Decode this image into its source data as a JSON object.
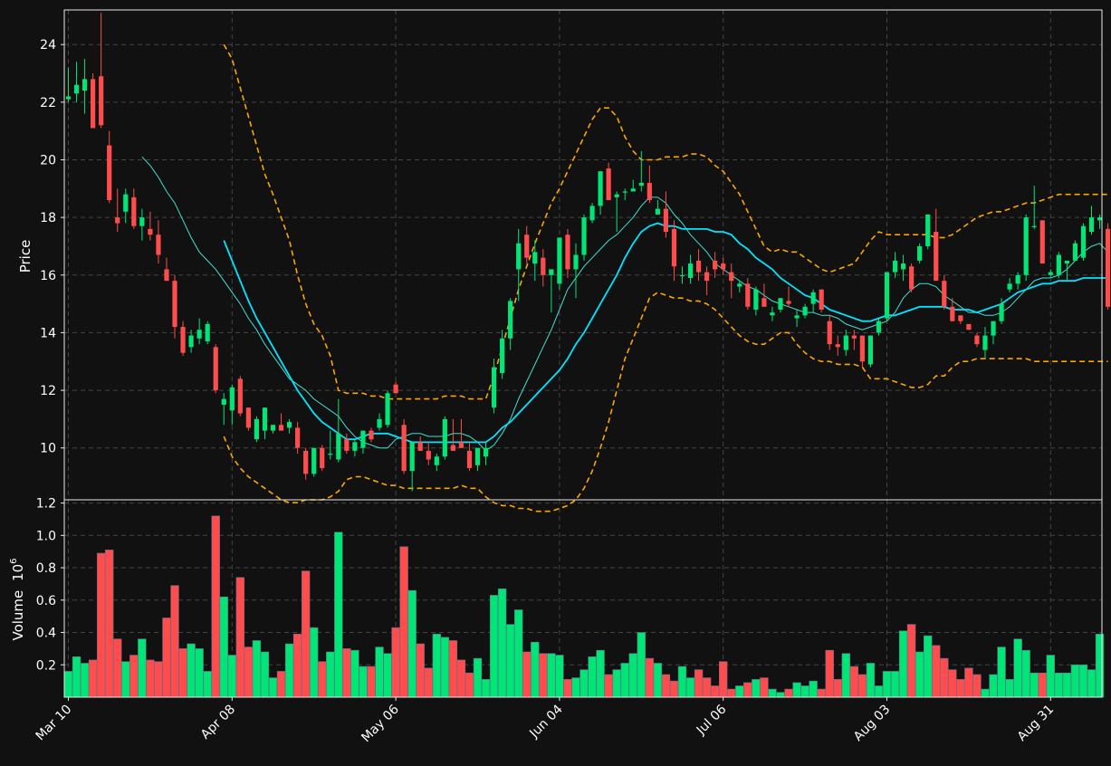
{
  "chart_data": {
    "type": "candlestick",
    "theme": {
      "background": "#111111",
      "up_color": "#00e676",
      "down_color": "#ff4d4d",
      "ma_fast_color": "#40e0d0",
      "ma_slow_color": "#00e5ff",
      "band_color": "#ffa500",
      "grid_color": "#444444",
      "text_color": "#ffffff"
    },
    "x_axis": {
      "tick_labels": [
        "Mar 10",
        "Apr 08",
        "May 06",
        "Jun 04",
        "Jul 06",
        "Aug 03",
        "Aug 31"
      ],
      "tick_indices": [
        0,
        20,
        40,
        60,
        80,
        100,
        120
      ],
      "label_rotation": 45
    },
    "price_panel": {
      "ylabel": "Price",
      "ylim": [
        8.2,
        25.2
      ],
      "yticks": [
        10,
        12,
        14,
        16,
        18,
        20,
        22,
        24
      ],
      "grid": true
    },
    "volume_panel": {
      "ylabel": "Volume",
      "ylabel_exponent": "6",
      "ylim": [
        0,
        1.22
      ],
      "yticks": [
        0.2,
        0.4,
        0.6,
        0.8,
        1.0,
        1.2
      ],
      "tick_labels": [
        "0.2",
        "0.4",
        "0.6",
        "0.8",
        "1.0",
        "1.2"
      ],
      "grid": true
    },
    "ohlc": [
      [
        22.1,
        23.2,
        22.0,
        22.2
      ],
      [
        22.3,
        23.4,
        22.0,
        22.6
      ],
      [
        22.4,
        23.5,
        21.6,
        22.8
      ],
      [
        22.8,
        23.0,
        21.1,
        21.1
      ],
      [
        22.9,
        25.1,
        21.1,
        21.2
      ],
      [
        20.5,
        21.0,
        18.5,
        18.6
      ],
      [
        18.0,
        19.0,
        17.5,
        17.8
      ],
      [
        18.2,
        19.0,
        17.8,
        18.8
      ],
      [
        18.7,
        19.0,
        17.6,
        17.7
      ],
      [
        17.7,
        18.3,
        17.2,
        18.0
      ],
      [
        17.6,
        18.2,
        17.2,
        17.4
      ],
      [
        17.4,
        17.9,
        16.4,
        16.7
      ],
      [
        16.2,
        16.6,
        15.8,
        15.8
      ],
      [
        15.8,
        16.0,
        13.8,
        14.2
      ],
      [
        14.2,
        14.4,
        13.2,
        13.3
      ],
      [
        13.5,
        14.1,
        13.3,
        13.9
      ],
      [
        13.8,
        14.5,
        13.6,
        14.1
      ],
      [
        13.7,
        14.4,
        13.6,
        14.3
      ],
      [
        13.5,
        13.6,
        11.9,
        12.0
      ],
      [
        11.5,
        11.9,
        10.8,
        11.7
      ],
      [
        11.3,
        12.2,
        10.8,
        12.1
      ],
      [
        12.4,
        12.5,
        11.1,
        11.2
      ],
      [
        11.4,
        11.4,
        10.6,
        10.7
      ],
      [
        10.3,
        11.1,
        10.2,
        11.0
      ],
      [
        10.6,
        11.4,
        10.3,
        11.4
      ],
      [
        10.6,
        10.8,
        10.5,
        10.8
      ],
      [
        10.8,
        11.2,
        10.6,
        10.6
      ],
      [
        10.7,
        11.0,
        10.5,
        10.9
      ],
      [
        10.7,
        10.9,
        9.8,
        10.0
      ],
      [
        9.9,
        10.0,
        8.9,
        9.1
      ],
      [
        9.1,
        10.0,
        9.0,
        10.0
      ],
      [
        10.0,
        10.1,
        9.2,
        9.3
      ],
      [
        9.8,
        10.6,
        9.6,
        9.8
      ],
      [
        9.6,
        11.7,
        9.5,
        10.5
      ],
      [
        10.3,
        10.5,
        9.8,
        9.9
      ],
      [
        9.9,
        10.3,
        9.7,
        10.2
      ],
      [
        10.0,
        10.6,
        9.8,
        10.6
      ],
      [
        10.6,
        10.7,
        10.2,
        10.3
      ],
      [
        10.7,
        11.2,
        10.6,
        11.0
      ],
      [
        10.8,
        12.0,
        10.7,
        11.9
      ],
      [
        12.2,
        12.3,
        11.9,
        11.9
      ],
      [
        10.8,
        11.0,
        9.1,
        9.2
      ],
      [
        9.2,
        10.2,
        8.5,
        10.2
      ],
      [
        10.2,
        10.4,
        9.9,
        9.9
      ],
      [
        9.9,
        10.2,
        9.4,
        9.6
      ],
      [
        9.4,
        9.8,
        9.2,
        9.7
      ],
      [
        9.7,
        11.1,
        9.6,
        11.0
      ],
      [
        10.1,
        11.0,
        9.9,
        9.9
      ],
      [
        10.2,
        11.0,
        10.0,
        10.0
      ],
      [
        9.9,
        10.2,
        9.2,
        9.3
      ],
      [
        9.4,
        10.0,
        9.2,
        10.0
      ],
      [
        9.7,
        10.2,
        9.4,
        10.0
      ],
      [
        11.4,
        13.1,
        11.2,
        12.8
      ],
      [
        12.6,
        14.1,
        12.4,
        13.8
      ],
      [
        13.8,
        15.2,
        13.4,
        15.1
      ],
      [
        16.2,
        17.6,
        15.1,
        17.1
      ],
      [
        17.4,
        17.7,
        16.4,
        16.6
      ],
      [
        16.4,
        17.2,
        15.8,
        16.8
      ],
      [
        16.6,
        16.9,
        15.6,
        16.0
      ],
      [
        16.0,
        16.2,
        14.7,
        16.2
      ],
      [
        15.7,
        17.3,
        15.5,
        17.3
      ],
      [
        17.4,
        17.6,
        15.9,
        16.2
      ],
      [
        16.2,
        17.1,
        15.2,
        16.7
      ],
      [
        16.7,
        18.1,
        16.5,
        18.0
      ],
      [
        17.9,
        18.5,
        17.8,
        18.4
      ],
      [
        18.4,
        19.6,
        18.1,
        19.6
      ],
      [
        19.7,
        19.9,
        18.6,
        18.6
      ],
      [
        18.7,
        18.9,
        17.5,
        18.8
      ],
      [
        18.9,
        19.0,
        18.6,
        18.9
      ],
      [
        18.9,
        19.3,
        18.9,
        19.0
      ],
      [
        19.1,
        20.3,
        18.9,
        19.2
      ],
      [
        19.2,
        19.8,
        18.5,
        18.6
      ],
      [
        18.1,
        18.6,
        18.1,
        18.3
      ],
      [
        18.3,
        18.9,
        17.3,
        17.5
      ],
      [
        17.6,
        17.9,
        15.8,
        16.3
      ],
      [
        16.0,
        16.3,
        15.7,
        16.0
      ],
      [
        15.9,
        16.7,
        15.7,
        16.4
      ],
      [
        16.5,
        16.9,
        15.8,
        16.1
      ],
      [
        16.1,
        16.3,
        15.3,
        15.8
      ],
      [
        16.5,
        16.8,
        15.9,
        16.2
      ],
      [
        16.4,
        16.6,
        16.0,
        16.2
      ],
      [
        16.1,
        16.4,
        15.2,
        15.8
      ],
      [
        15.6,
        15.8,
        15.4,
        15.7
      ],
      [
        15.7,
        15.9,
        14.8,
        14.9
      ],
      [
        14.8,
        15.6,
        14.6,
        15.5
      ],
      [
        15.2,
        15.7,
        14.9,
        14.9
      ],
      [
        14.6,
        14.9,
        14.4,
        14.7
      ],
      [
        14.8,
        15.2,
        14.7,
        15.2
      ],
      [
        15.1,
        15.6,
        14.9,
        15.0
      ],
      [
        14.5,
        14.8,
        14.2,
        14.6
      ],
      [
        14.6,
        15.0,
        14.5,
        14.9
      ],
      [
        15.0,
        15.5,
        14.7,
        15.4
      ],
      [
        15.5,
        15.5,
        14.7,
        14.8
      ],
      [
        14.4,
        14.6,
        13.4,
        13.6
      ],
      [
        13.6,
        13.9,
        13.2,
        13.5
      ],
      [
        13.4,
        14.1,
        13.2,
        13.9
      ],
      [
        13.9,
        14.1,
        13.4,
        13.8
      ],
      [
        13.9,
        13.9,
        12.8,
        13.0
      ],
      [
        12.9,
        13.9,
        12.8,
        13.9
      ],
      [
        14.0,
        14.5,
        13.9,
        14.4
      ],
      [
        14.5,
        16.1,
        14.4,
        16.1
      ],
      [
        16.1,
        16.8,
        15.9,
        16.5
      ],
      [
        16.2,
        16.7,
        15.8,
        16.4
      ],
      [
        16.3,
        16.4,
        15.4,
        15.5
      ],
      [
        16.5,
        17.1,
        16.4,
        17.0
      ],
      [
        17.0,
        18.1,
        16.9,
        18.1
      ],
      [
        17.5,
        18.3,
        17.3,
        15.8
      ],
      [
        15.8,
        16.0,
        14.8,
        14.9
      ],
      [
        14.9,
        15.2,
        14.4,
        14.4
      ],
      [
        14.6,
        14.6,
        14.3,
        14.4
      ],
      [
        14.3,
        14.3,
        14.1,
        14.1
      ],
      [
        13.9,
        14.0,
        13.5,
        13.6
      ],
      [
        13.4,
        14.2,
        13.1,
        13.9
      ],
      [
        13.9,
        14.4,
        13.6,
        14.4
      ],
      [
        14.4,
        15.2,
        14.3,
        15.0
      ],
      [
        15.5,
        15.9,
        15.4,
        15.7
      ],
      [
        15.7,
        16.1,
        15.5,
        16.0
      ],
      [
        16.0,
        18.1,
        15.8,
        18.0
      ],
      [
        17.7,
        19.1,
        17.6,
        17.7
      ],
      [
        17.9,
        17.9,
        16.4,
        16.4
      ],
      [
        16.0,
        16.2,
        15.9,
        16.1
      ],
      [
        16.0,
        16.8,
        15.9,
        16.7
      ],
      [
        16.4,
        16.5,
        15.8,
        16.5
      ],
      [
        16.5,
        17.2,
        16.5,
        17.1
      ],
      [
        16.6,
        17.8,
        16.5,
        17.7
      ],
      [
        17.5,
        18.4,
        17.4,
        18.0
      ],
      [
        17.9,
        18.1,
        17.6,
        18.0
      ],
      [
        17.6,
        17.8,
        14.8,
        14.9
      ]
    ],
    "ma_fast": [
      null,
      null,
      null,
      null,
      null,
      null,
      null,
      null,
      null,
      20.1,
      19.8,
      19.4,
      18.9,
      18.5,
      17.9,
      17.3,
      16.8,
      16.5,
      16.2,
      15.8,
      15.4,
      15.0,
      14.5,
      14.1,
      13.6,
      13.2,
      12.8,
      12.4,
      12.2,
      12.0,
      11.7,
      11.5,
      11.3,
      11.1,
      10.7,
      10.4,
      10.2,
      10.1,
      10.0,
      10.0,
      10.3,
      10.4,
      10.5,
      10.5,
      10.4,
      10.4,
      10.4,
      10.5,
      10.5,
      10.4,
      10.2,
      9.9,
      10.1,
      10.5,
      11.0,
      11.7,
      12.3,
      12.9,
      13.5,
      14.1,
      14.8,
      15.5,
      15.9,
      16.3,
      16.6,
      16.9,
      17.2,
      17.4,
      17.7,
      18.0,
      18.4,
      18.7,
      18.7,
      18.5,
      18.1,
      17.8,
      17.4,
      17.1,
      16.8,
      16.4,
      16.2,
      16.0,
      15.8,
      15.6,
      15.5,
      15.3,
      15.1,
      15.0,
      14.9,
      14.8,
      14.7,
      14.7,
      14.6,
      14.6,
      14.5,
      14.3,
      14.2,
      14.1,
      14.2,
      14.3,
      14.4,
      14.7,
      15.2,
      15.5,
      15.7,
      15.7,
      15.6,
      15.3,
      15.1,
      14.9,
      14.7,
      14.7,
      14.6,
      14.6,
      14.7,
      14.9,
      15.2,
      15.5,
      15.8,
      15.9,
      15.9,
      16.0,
      16.2,
      16.5,
      16.8,
      17.0,
      17.1,
      16.8
    ],
    "ma_slow": [
      null,
      null,
      null,
      null,
      null,
      null,
      null,
      null,
      null,
      null,
      null,
      null,
      null,
      null,
      null,
      null,
      null,
      null,
      null,
      17.2,
      16.5,
      15.8,
      15.1,
      14.5,
      14.0,
      13.5,
      13.0,
      12.5,
      12.0,
      11.6,
      11.2,
      10.9,
      10.7,
      10.5,
      10.3,
      10.3,
      10.4,
      10.5,
      10.5,
      10.5,
      10.4,
      10.3,
      10.2,
      10.2,
      10.2,
      10.2,
      10.2,
      10.2,
      10.2,
      10.2,
      10.2,
      10.2,
      10.4,
      10.7,
      10.9,
      11.2,
      11.5,
      11.8,
      12.1,
      12.4,
      12.7,
      13.1,
      13.6,
      14.0,
      14.5,
      15.0,
      15.5,
      16.0,
      16.6,
      17.1,
      17.5,
      17.7,
      17.8,
      17.7,
      17.7,
      17.6,
      17.6,
      17.6,
      17.6,
      17.5,
      17.5,
      17.4,
      17.1,
      16.9,
      16.6,
      16.4,
      16.2,
      15.9,
      15.7,
      15.5,
      15.3,
      15.2,
      15.0,
      14.8,
      14.7,
      14.6,
      14.5,
      14.4,
      14.4,
      14.5,
      14.6,
      14.6,
      14.7,
      14.8,
      14.9,
      14.9,
      14.9,
      14.9,
      14.8,
      14.8,
      14.8,
      14.7,
      14.8,
      14.9,
      15.0,
      15.2,
      15.4,
      15.5,
      15.6,
      15.7,
      15.7,
      15.8,
      15.8,
      15.8,
      15.9,
      15.9,
      15.9,
      15.9
    ],
    "band_upper": [
      null,
      null,
      null,
      null,
      null,
      null,
      null,
      null,
      null,
      null,
      null,
      null,
      null,
      null,
      null,
      null,
      null,
      null,
      null,
      24.0,
      23.5,
      22.5,
      21.5,
      20.5,
      19.5,
      18.8,
      18.0,
      17.2,
      16.0,
      15.0,
      14.3,
      13.9,
      13.2,
      12.0,
      11.9,
      11.9,
      11.9,
      11.8,
      11.8,
      11.7,
      11.7,
      11.7,
      11.7,
      11.7,
      11.7,
      11.7,
      11.8,
      11.8,
      11.8,
      11.7,
      11.7,
      11.7,
      12.5,
      13.5,
      14.5,
      15.5,
      16.3,
      17.1,
      17.8,
      18.5,
      19.0,
      19.6,
      20.2,
      20.8,
      21.4,
      21.8,
      21.8,
      21.5,
      20.8,
      20.3,
      20.0,
      20.0,
      20.0,
      20.1,
      20.1,
      20.1,
      20.2,
      20.2,
      20.1,
      19.8,
      19.6,
      19.2,
      18.8,
      18.2,
      17.6,
      17.0,
      16.8,
      16.9,
      16.8,
      16.8,
      16.6,
      16.4,
      16.2,
      16.1,
      16.2,
      16.3,
      16.4,
      16.8,
      17.2,
      17.5,
      17.4,
      17.4,
      17.4,
      17.4,
      17.4,
      17.4,
      17.3,
      17.3,
      17.4,
      17.6,
      17.8,
      18.0,
      18.1,
      18.2,
      18.2,
      18.3,
      18.4,
      18.5,
      18.5,
      18.6,
      18.7,
      18.8,
      18.8,
      18.8,
      18.8,
      18.8,
      18.8,
      18.8
    ],
    "band_lower": [
      null,
      null,
      null,
      null,
      null,
      null,
      null,
      null,
      null,
      null,
      null,
      null,
      null,
      null,
      null,
      null,
      null,
      null,
      null,
      10.4,
      9.7,
      9.3,
      9.0,
      8.8,
      8.6,
      8.4,
      8.2,
      8.1,
      8.1,
      8.2,
      8.2,
      8.2,
      8.3,
      8.5,
      8.9,
      9.0,
      9.0,
      8.9,
      8.8,
      8.7,
      8.7,
      8.6,
      8.6,
      8.6,
      8.6,
      8.6,
      8.6,
      8.6,
      8.7,
      8.6,
      8.6,
      8.3,
      8.1,
      8.0,
      8.0,
      7.9,
      7.9,
      7.8,
      7.8,
      7.8,
      7.9,
      8.0,
      8.2,
      8.6,
      9.2,
      10.0,
      10.9,
      12.0,
      13.1,
      13.8,
      14.5,
      15.2,
      15.4,
      15.3,
      15.2,
      15.2,
      15.1,
      15.1,
      15.0,
      14.8,
      14.5,
      14.2,
      13.9,
      13.7,
      13.6,
      13.6,
      13.8,
      14.0,
      14.0,
      13.6,
      13.3,
      13.1,
      13.0,
      13.0,
      12.9,
      12.9,
      12.9,
      12.8,
      12.4,
      12.4,
      12.4,
      12.3,
      12.2,
      12.1,
      12.1,
      12.2,
      12.5,
      12.5,
      12.8,
      13.0,
      13.0,
      13.1,
      13.1,
      13.1,
      13.1,
      13.1,
      13.1,
      13.1,
      13.0,
      13.0,
      13.0,
      13.0,
      13.0,
      13.0,
      13.0,
      13.0,
      13.0,
      13.0
    ],
    "volume_millions": [
      0.16,
      0.25,
      0.21,
      0.23,
      0.89,
      0.91,
      0.36,
      0.22,
      0.26,
      0.36,
      0.23,
      0.22,
      0.49,
      0.69,
      0.3,
      0.33,
      0.3,
      0.16,
      1.12,
      0.62,
      0.26,
      0.74,
      0.31,
      0.35,
      0.28,
      0.12,
      0.16,
      0.33,
      0.39,
      0.78,
      0.43,
      0.22,
      0.28,
      1.02,
      0.3,
      0.29,
      0.19,
      0.19,
      0.31,
      0.27,
      0.43,
      0.93,
      0.66,
      0.33,
      0.18,
      0.39,
      0.37,
      0.35,
      0.23,
      0.15,
      0.24,
      0.11,
      0.63,
      0.67,
      0.45,
      0.54,
      0.28,
      0.34,
      0.27,
      0.27,
      0.26,
      0.11,
      0.12,
      0.17,
      0.25,
      0.29,
      0.14,
      0.17,
      0.21,
      0.27,
      0.4,
      0.24,
      0.21,
      0.14,
      0.1,
      0.19,
      0.12,
      0.17,
      0.12,
      0.07,
      0.22,
      0.05,
      0.07,
      0.09,
      0.11,
      0.12,
      0.05,
      0.03,
      0.05,
      0.09,
      0.07,
      0.1,
      0.05,
      0.29,
      0.11,
      0.27,
      0.19,
      0.14,
      0.21,
      0.07,
      0.16,
      0.16,
      0.41,
      0.45,
      0.28,
      0.38,
      0.32,
      0.24,
      0.17,
      0.11,
      0.18,
      0.14,
      0.05,
      0.14,
      0.31,
      0.11,
      0.36,
      0.29,
      0.15,
      0.15,
      0.26,
      0.15,
      0.15,
      0.2,
      0.2,
      0.17,
      0.39
    ]
  }
}
